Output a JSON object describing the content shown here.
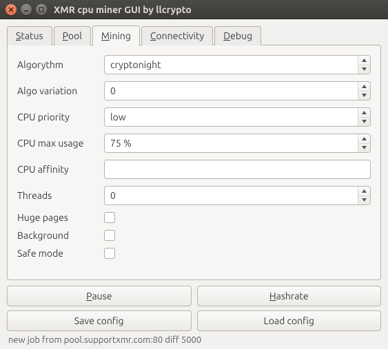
{
  "window": {
    "title": "XMR cpu miner GUI by llcrypto"
  },
  "tabs": {
    "items": [
      {
        "label": "Status",
        "mnemonic_index": 0,
        "active": false
      },
      {
        "label": "Pool",
        "mnemonic_index": 0,
        "active": false
      },
      {
        "label": "Mining",
        "mnemonic_index": 0,
        "active": true
      },
      {
        "label": "Connectivity",
        "mnemonic_index": 0,
        "active": false
      },
      {
        "label": "Debug",
        "mnemonic_index": 0,
        "active": false
      }
    ]
  },
  "mining": {
    "algorythm": {
      "label": "Algorythm",
      "value": "cryptonight",
      "kind": "combo"
    },
    "algo_variation": {
      "label": "Algo variation",
      "value": "0",
      "kind": "spin"
    },
    "cpu_priority": {
      "label": "CPU priority",
      "value": "low",
      "kind": "combo"
    },
    "cpu_max_usage": {
      "label": "CPU max usage",
      "value": "75 %",
      "kind": "spin"
    },
    "cpu_affinity": {
      "label": "CPU affinity",
      "value": "",
      "kind": "text"
    },
    "threads": {
      "label": "Threads",
      "value": "0",
      "kind": "spin"
    },
    "huge_pages": {
      "label": "Huge pages",
      "checked": false,
      "kind": "check"
    },
    "background": {
      "label": "Background",
      "checked": false,
      "kind": "check"
    },
    "safe_mode": {
      "label": "Safe mode",
      "checked": false,
      "kind": "check"
    }
  },
  "buttons": {
    "pause": {
      "label": "Pause",
      "mnemonic_index": 0
    },
    "hashrate": {
      "label": "Hashrate",
      "mnemonic_index": 0
    },
    "save_config": {
      "label": "Save config",
      "mnemonic_index": null
    },
    "load_config": {
      "label": "Load config",
      "mnemonic_index": null
    }
  },
  "status_line": "new job from pool.supportxmr.com:80 diff 5000"
}
